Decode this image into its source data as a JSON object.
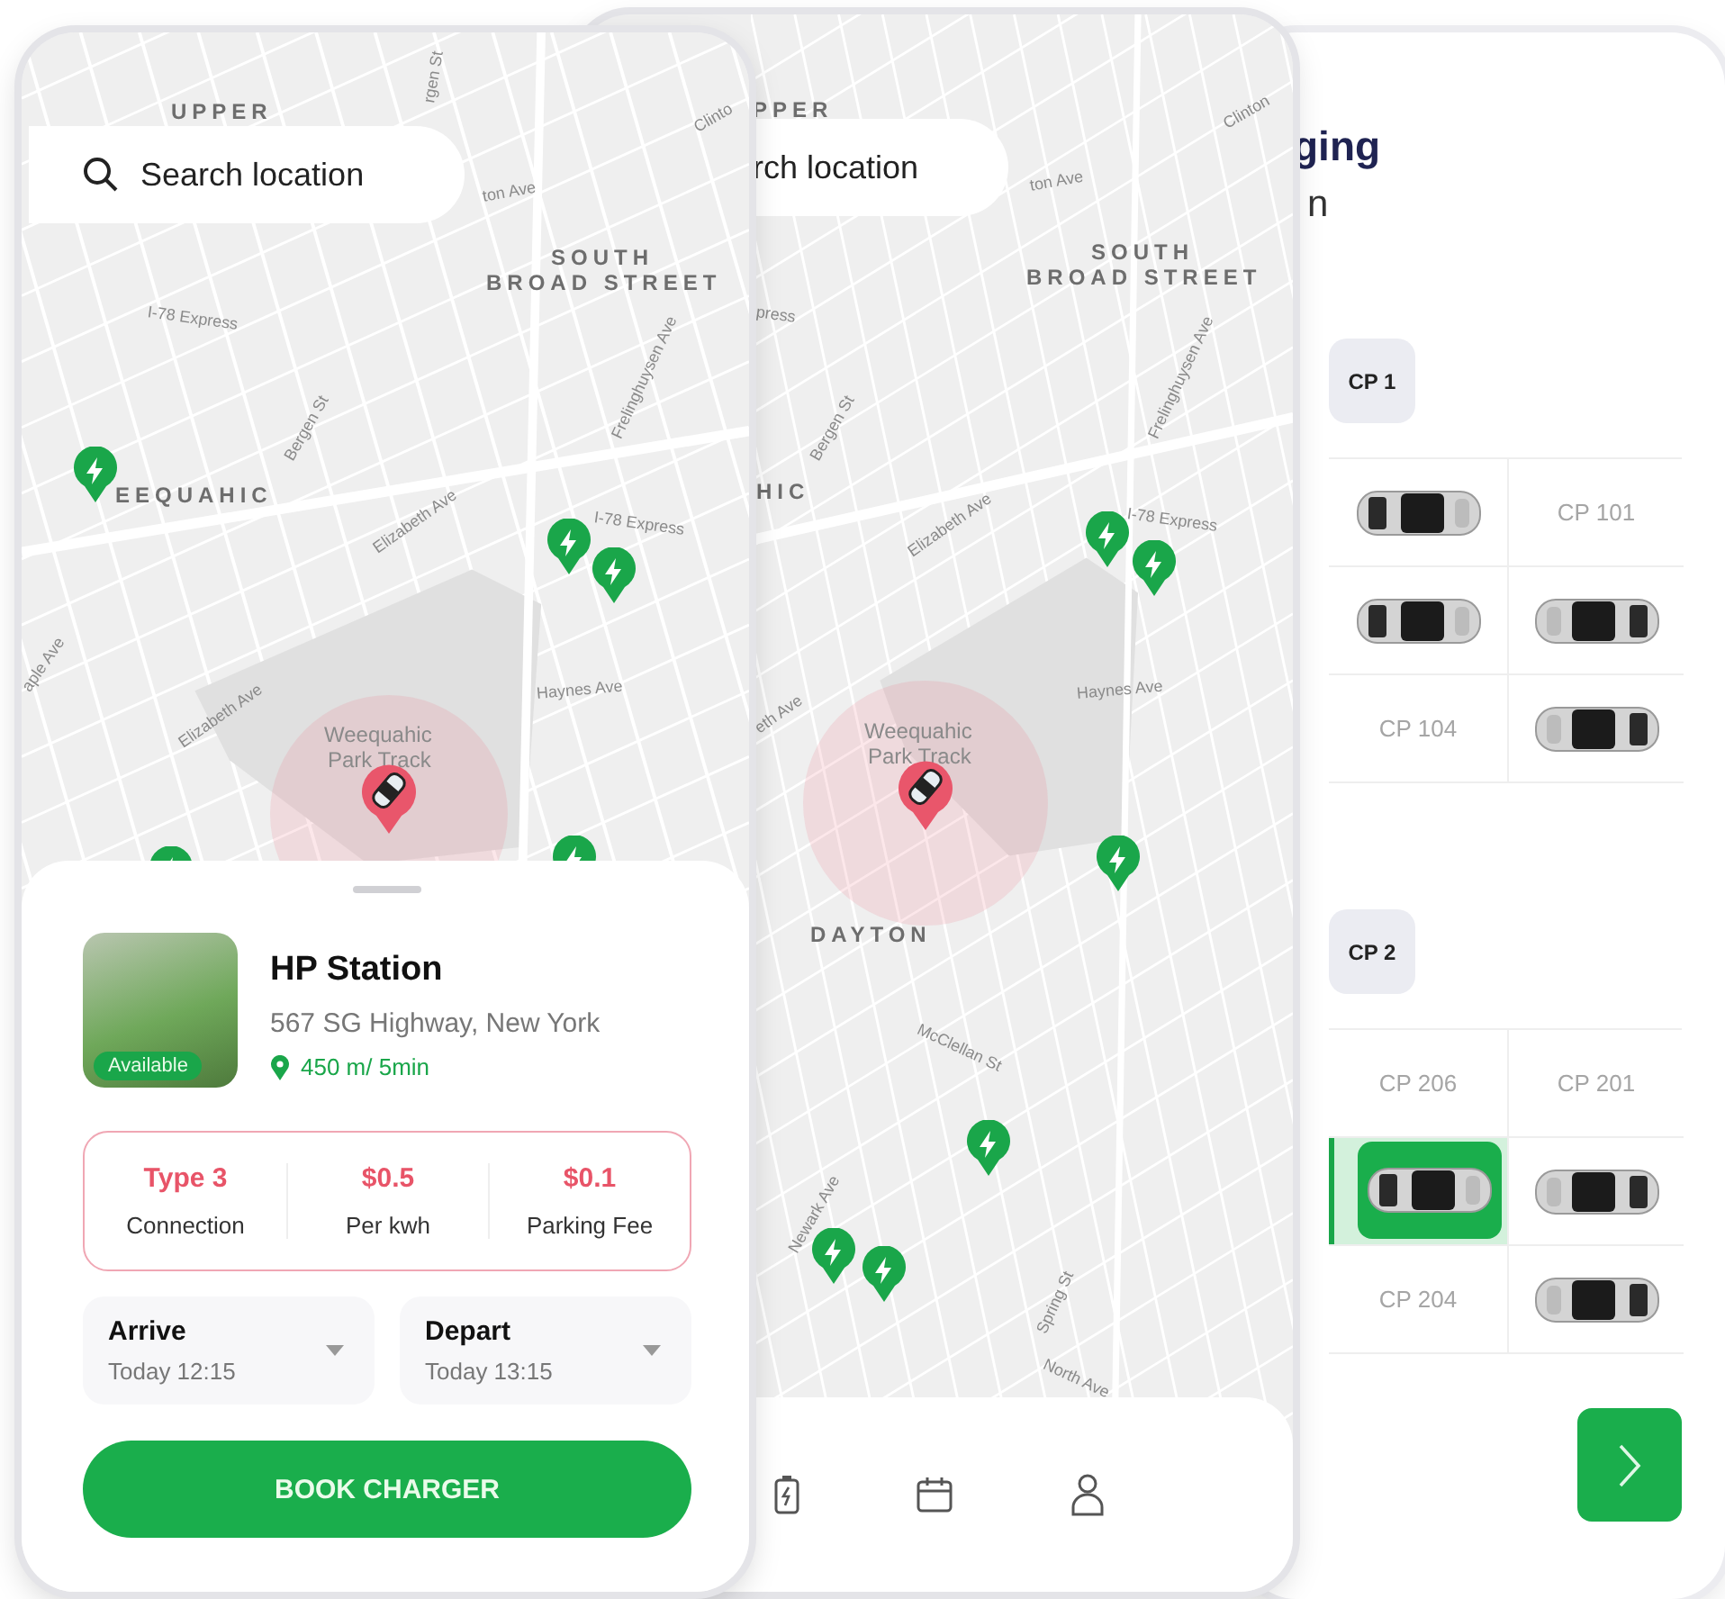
{
  "map_screen": {
    "search": {
      "placeholder": "Search location"
    },
    "map_labels": [
      {
        "text": "UPPER",
        "kind": "district"
      },
      {
        "text": "rgen St",
        "kind": "street"
      },
      {
        "text": "Clinto",
        "kind": "street"
      },
      {
        "text": "ton Ave",
        "kind": "street"
      },
      {
        "text": "SOUTH",
        "kind": "district"
      },
      {
        "text": "BROAD STREET",
        "kind": "district"
      },
      {
        "text": "I-78 Express",
        "kind": "street"
      },
      {
        "text": "Frelinghuysen Ave",
        "kind": "street"
      },
      {
        "text": "Bergen St",
        "kind": "street"
      },
      {
        "text": "EEQUAHIC",
        "kind": "district"
      },
      {
        "text": "Elizabeth Ave",
        "kind": "street"
      },
      {
        "text": "I-78 Express",
        "kind": "street"
      },
      {
        "text": "aple Ave",
        "kind": "street"
      },
      {
        "text": "Elizabeth Ave",
        "kind": "street"
      },
      {
        "text": "Haynes Ave",
        "kind": "street"
      },
      {
        "text": "Weequahic",
        "kind": "poi"
      },
      {
        "text": "Park Track",
        "kind": "poi"
      }
    ],
    "station": {
      "name": "HP Station",
      "address": "567  SG Highway, New York",
      "distance": "450 m/ 5min",
      "badge": "Available"
    },
    "specs": [
      {
        "value": "Type 3",
        "label": "Connection"
      },
      {
        "value": "$0.5",
        "label": "Per kwh"
      },
      {
        "value": "$0.1",
        "label": "Parking Fee"
      }
    ],
    "times": [
      {
        "label": "Arrive",
        "value": "Today 12:15"
      },
      {
        "label": "Depart",
        "value": "Today 13:15"
      }
    ],
    "book_button": "BOOK CHARGER"
  },
  "browse_screen": {
    "search": {
      "placeholder": "rch location"
    },
    "map_labels": [
      {
        "text": "Clinton",
        "kind": "street"
      },
      {
        "text": "PPER",
        "kind": "district"
      },
      {
        "text": "ton Ave",
        "kind": "street"
      },
      {
        "text": "SOUTH",
        "kind": "district"
      },
      {
        "text": "BROAD STREET",
        "kind": "district"
      },
      {
        "text": "press",
        "kind": "street"
      },
      {
        "text": "Bergen St",
        "kind": "street"
      },
      {
        "text": "Frelinghuysen Ave",
        "kind": "street"
      },
      {
        "text": "HIC",
        "kind": "district"
      },
      {
        "text": "Elizabeth Ave",
        "kind": "street"
      },
      {
        "text": "I-78 Express",
        "kind": "street"
      },
      {
        "text": "eth Ave",
        "kind": "street"
      },
      {
        "text": "Haynes Ave",
        "kind": "street"
      },
      {
        "text": "Weequahic",
        "kind": "poi"
      },
      {
        "text": "Park Track",
        "kind": "poi"
      },
      {
        "text": "DAYTON",
        "kind": "district"
      },
      {
        "text": "McClellan St",
        "kind": "street"
      },
      {
        "text": "Newark Ave",
        "kind": "street"
      },
      {
        "text": "Spring St",
        "kind": "street"
      },
      {
        "text": "North Ave",
        "kind": "street"
      }
    ]
  },
  "slot_screen": {
    "title": "ging",
    "subtitle": "n",
    "sections": [
      {
        "label": "CP 1",
        "slots": [
          {
            "kind": "car",
            "selected": false
          },
          {
            "kind": "free",
            "label": "CP 101",
            "selected": false
          },
          {
            "kind": "car",
            "selected": false
          },
          {
            "kind": "car",
            "selected": false
          },
          {
            "kind": "free",
            "label": "CP 104",
            "selected": false
          },
          {
            "kind": "car",
            "selected": false
          }
        ]
      },
      {
        "label": "CP 2",
        "slots": [
          {
            "kind": "free",
            "label": "CP 206",
            "selected": false
          },
          {
            "kind": "free",
            "label": "CP 201",
            "selected": false
          },
          {
            "kind": "car",
            "selected": true
          },
          {
            "kind": "car",
            "selected": false
          },
          {
            "kind": "free",
            "label": "CP 204",
            "selected": false
          },
          {
            "kind": "car",
            "selected": false
          }
        ]
      }
    ]
  }
}
